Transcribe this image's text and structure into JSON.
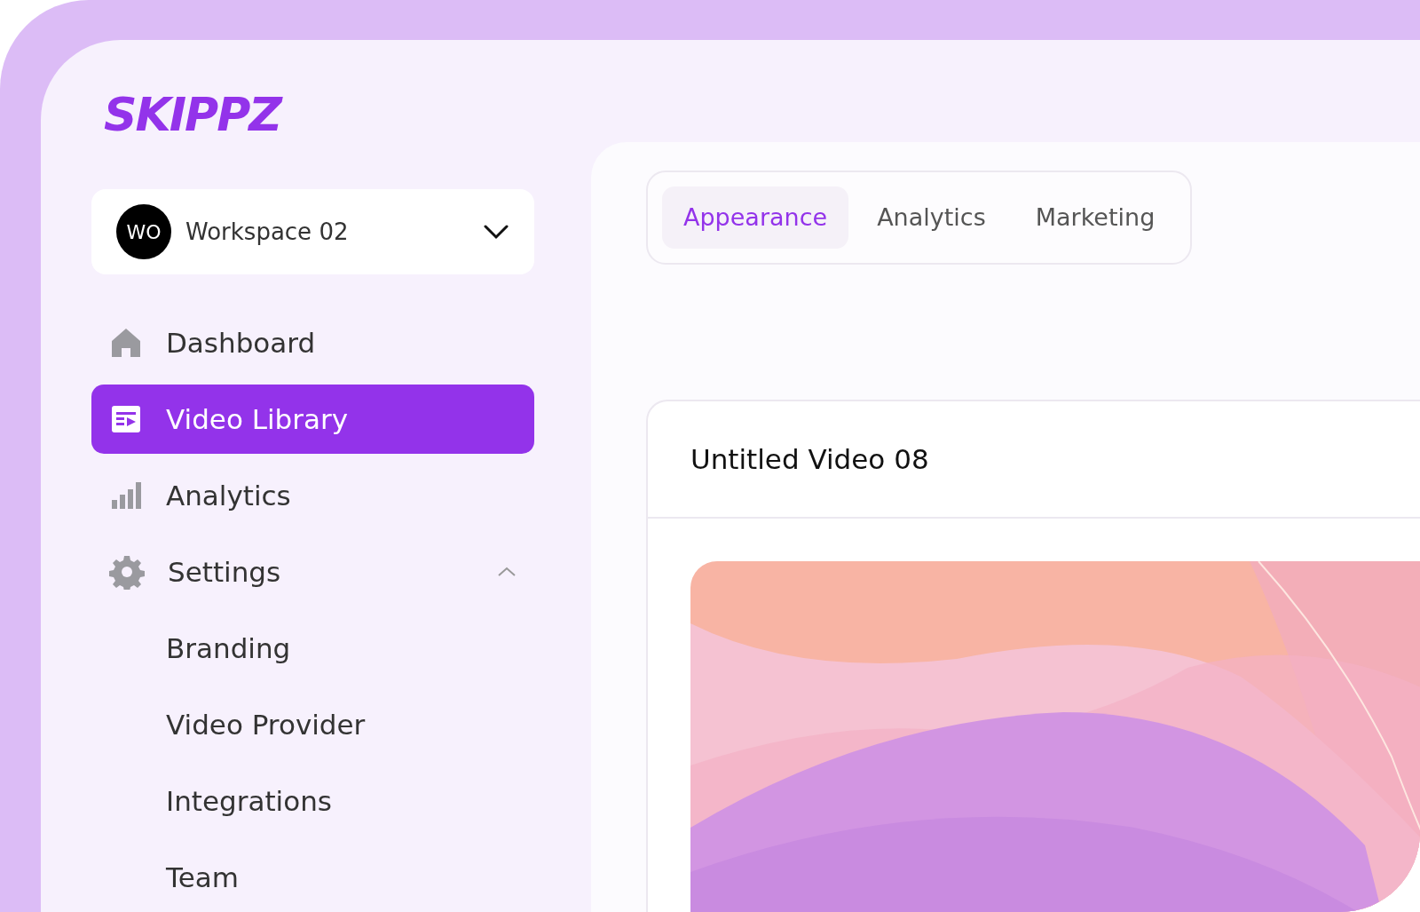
{
  "logo": "SKIPPZ",
  "workspace": {
    "initials": "WO",
    "name": "Workspace 02"
  },
  "nav": [
    {
      "label": "Dashboard",
      "selected": false
    },
    {
      "label": "Video Library",
      "selected": true
    },
    {
      "label": "Analytics",
      "selected": false
    },
    {
      "label": "Settings",
      "selected": false,
      "expanded": true,
      "children": [
        {
          "label": "Branding"
        },
        {
          "label": "Video Provider"
        },
        {
          "label": "Integrations"
        },
        {
          "label": "Team"
        }
      ]
    }
  ],
  "tabs": [
    {
      "label": "Appearance",
      "selected": true
    },
    {
      "label": "Analytics",
      "selected": false
    },
    {
      "label": "Marketing",
      "selected": false
    }
  ],
  "video": {
    "title": "Untitled Video 08"
  }
}
